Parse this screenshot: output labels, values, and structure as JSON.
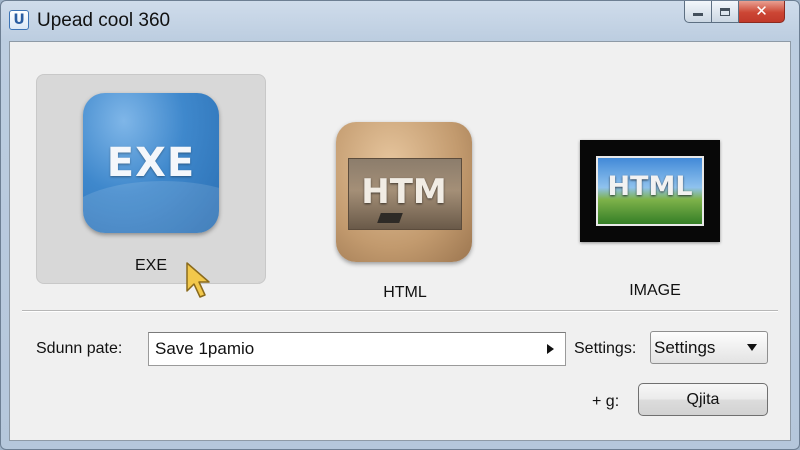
{
  "window": {
    "title": "Upead cool 360",
    "icon": "app-logo-icon",
    "icon_glyph": "U",
    "controls": {
      "minimize_icon": "minimize-icon",
      "maximize_icon": "maximize-icon",
      "close_icon": "close-icon",
      "close_glyph": "✕"
    }
  },
  "formats": [
    {
      "id": "exe",
      "label": "EXE",
      "icon_text": "EXE",
      "icon": "exe-icon",
      "selected": true
    },
    {
      "id": "html",
      "label": "HTML",
      "icon_text": "HTM",
      "icon": "html-icon",
      "selected": false
    },
    {
      "id": "image",
      "label": "IMAGE",
      "icon_text": "HTML",
      "icon": "image-icon",
      "selected": false
    }
  ],
  "cursor": {
    "icon": "mouse-pointer-icon"
  },
  "save_path": {
    "label": "Sdunn pate:",
    "value": "Save 1pamio",
    "browse_icon": "play-arrow-icon"
  },
  "settings": {
    "label": "Settings:",
    "selected": "Settings",
    "dropdown_icon": "chevron-down-icon"
  },
  "footer": {
    "extra_label": "+ g:",
    "quit_label": "Qjita"
  },
  "colors": {
    "title_bar": "#c3d3e5",
    "close_button": "#cc4634",
    "exe_icon_blue": "#3f88cc",
    "html_icon_tan": "#c29a6e",
    "cursor_yellow": "#f2c84b",
    "selection_gray": "#d8d8d8"
  }
}
